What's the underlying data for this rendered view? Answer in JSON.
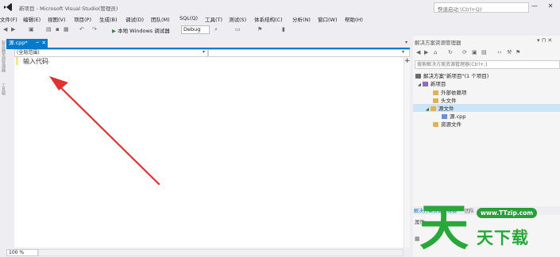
{
  "window": {
    "title": "新项目 - Microsoft Visual Studio(管理员)",
    "quick_launch_placeholder": "快速启动 (Ctrl+Q)",
    "search_glyph": "⌕",
    "min_glyph": "—",
    "close_glyph": "✕"
  },
  "menu": [
    "文件(F)",
    "编辑(E)",
    "视图(V)",
    "项目(P)",
    "生成(B)",
    "调试(D)",
    "团队(M)",
    "SQL(Q)",
    "工具(T)",
    "测试(S)",
    "体系结构(C)",
    "分析(N)",
    "窗口(W)",
    "帮助(H)"
  ],
  "toolbar": {
    "start_label": "本地 Windows 调试器",
    "start_glyph": "▶",
    "config": "Debug"
  },
  "left_strip": [
    "服务器资源管理器",
    "工具箱"
  ],
  "editor": {
    "tab_label": "源.cpp*",
    "tab_close": "✕",
    "tab_pin": "⊸",
    "nav_scope": "(全局范围)",
    "dropdown_glyph": "▾",
    "code": "输入代码",
    "plus_glyph": "+",
    "zoom": "100 %"
  },
  "arrow": {
    "color": "#e03030"
  },
  "solution_explorer": {
    "title": "解决方案资源管理器",
    "title_icons": "▾ ⊓ ✕",
    "search_placeholder": "搜索解决方案资源管理器(Ctrl+;)",
    "tree": [
      {
        "label": "解决方案\"新项目\"(1 个项目)",
        "icon": "solution-icon",
        "expand": ""
      },
      {
        "label": "新项目",
        "icon": "project-icon",
        "expand": "◢"
      },
      {
        "label": "外部依赖项",
        "icon": "folder-icon",
        "expand": ""
      },
      {
        "label": "头文件",
        "icon": "folder-icon",
        "expand": ""
      },
      {
        "label": "源文件",
        "icon": "folder-icon",
        "expand": "◢"
      },
      {
        "label": "源.cpp",
        "icon": "cpp-file-icon",
        "expand": ""
      },
      {
        "label": "资源文件",
        "icon": "folder-icon",
        "expand": ""
      }
    ],
    "tab_active": "解决方案资源管理器",
    "tab_2": "团队"
  },
  "properties": {
    "title": "属性"
  },
  "watermark": {
    "glyph": "天",
    "url": "www.TTzip.com",
    "text": "天下载",
    "color": "#29a83a"
  }
}
